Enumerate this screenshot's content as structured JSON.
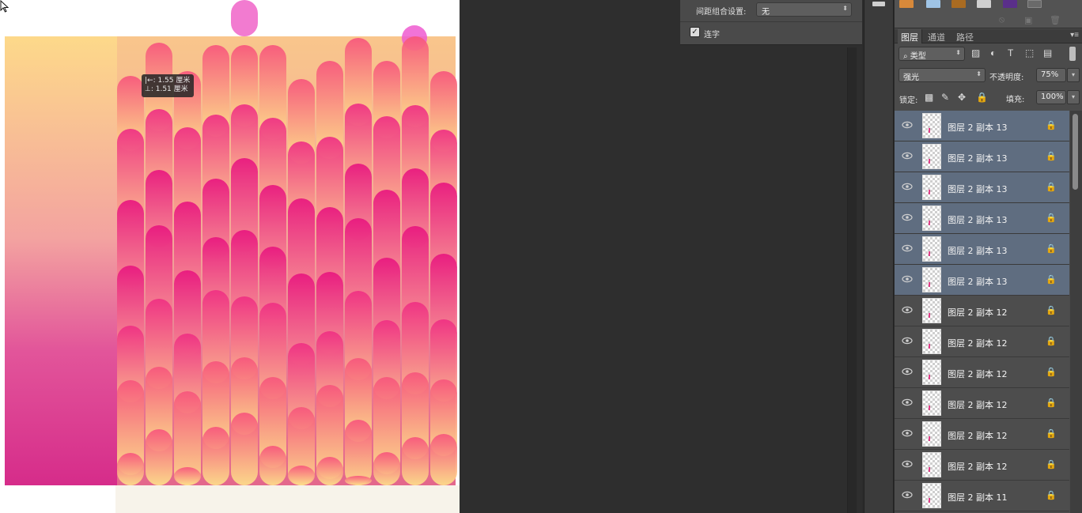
{
  "canvas": {
    "tooltip_line1": "|←: 1.55 厘米",
    "tooltip_line2": "⊥: 1.51 厘米"
  },
  "character_panel": {
    "spacing_label": "间距组合设置:",
    "spacing_value": "无",
    "ligature_label": "连字",
    "ligature_checked": true
  },
  "layers_panel": {
    "tabs": [
      "图层",
      "通道",
      "路径"
    ],
    "active_tab": "图层",
    "filter_kind": "类型",
    "blend_mode": "强光",
    "opacity_label": "不透明度:",
    "opacity_value": "75%",
    "lock_label": "锁定:",
    "fill_label": "填充:",
    "fill_value": "100%",
    "layers": [
      {
        "name": "图层 2 副本 13",
        "selected": true
      },
      {
        "name": "图层 2 副本 13",
        "selected": true
      },
      {
        "name": "图层 2 副本 13",
        "selected": true
      },
      {
        "name": "图层 2 副本 13",
        "selected": true
      },
      {
        "name": "图层 2 副本 13",
        "selected": true
      },
      {
        "name": "图层 2 副本 13",
        "selected": true
      },
      {
        "name": "图层 2 副本 12",
        "selected": false
      },
      {
        "name": "图层 2 副本 12",
        "selected": false
      },
      {
        "name": "图层 2 副本 12",
        "selected": false
      },
      {
        "name": "图层 2 副本 12",
        "selected": false
      },
      {
        "name": "图层 2 副本 12",
        "selected": false
      },
      {
        "name": "图层 2 副本 12",
        "selected": false
      },
      {
        "name": "图层 2 副本 11",
        "selected": false
      }
    ]
  },
  "icons": {
    "eye": "eye-icon",
    "lock": "lock-icon",
    "checkbox": "checkbox-icon",
    "cursor": "cursor-arrow-icon"
  },
  "colors": {
    "selected_row": "#5f6d80",
    "panel_bg": "#4b4b4b",
    "pink": "#e8167f",
    "yellow": "#fddc84"
  }
}
